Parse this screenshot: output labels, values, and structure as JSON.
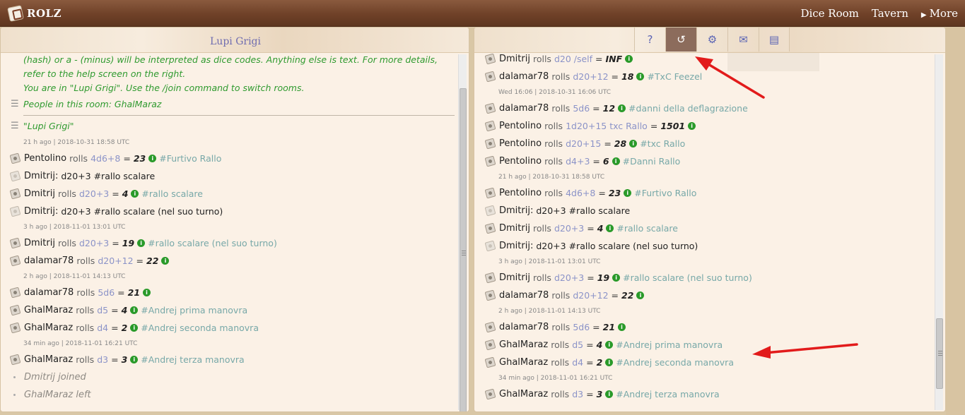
{
  "app": {
    "logo_text": "ROLZ",
    "nav": [
      {
        "label": "Dice Room"
      },
      {
        "label": "Tavern"
      },
      {
        "label": "More",
        "arrow": "▶"
      }
    ]
  },
  "left": {
    "room_title": "Lupi Grigi",
    "intro_lines": [
      "(hash) or a - (minus) will be interpreted as dice codes. Anything else is text. For more details,",
      "refer to the help screen on the right.",
      "You are in \"Lupi Grigi\". Use the /join command to switch rooms."
    ],
    "people_line": "People in this room: GhalMaraz",
    "room_line": "\"Lupi Grigi\"",
    "entries": [
      {
        "kind": "ts",
        "text": "21 h ago | 2018-10-31 18:58 UTC"
      },
      {
        "kind": "roll",
        "name": "Pentolino",
        "verb": "rolls",
        "code": "4d6+8",
        "eq": "=",
        "result": "23",
        "tag": "#Furtivo Rallo"
      },
      {
        "kind": "msg",
        "name": "Dmitrij:",
        "msg": "d20+3 #rallo scalare"
      },
      {
        "kind": "roll",
        "name": "Dmitrij",
        "verb": "rolls",
        "code": "d20+3",
        "eq": "=",
        "result": "4",
        "tag": "#rallo scalare"
      },
      {
        "kind": "msg",
        "name": "Dmitrij:",
        "msg": "d20+3 #rallo scalare (nel suo turno)"
      },
      {
        "kind": "ts",
        "text": "3 h ago | 2018-11-01 13:01 UTC"
      },
      {
        "kind": "roll",
        "name": "Dmitrij",
        "verb": "rolls",
        "code": "d20+3",
        "eq": "=",
        "result": "19",
        "tag": "#rallo scalare (nel suo turno)"
      },
      {
        "kind": "roll",
        "name": "dalamar78",
        "verb": "rolls",
        "code": "d20+12",
        "eq": "=",
        "result": "22",
        "tag": ""
      },
      {
        "kind": "ts",
        "text": "2 h ago | 2018-11-01 14:13 UTC"
      },
      {
        "kind": "roll",
        "name": "dalamar78",
        "verb": "rolls",
        "code": "5d6",
        "eq": "=",
        "result": "21",
        "tag": ""
      },
      {
        "kind": "roll",
        "name": "GhalMaraz",
        "verb": "rolls",
        "code": "d5",
        "eq": "=",
        "result": "4",
        "tag": "#Andrej prima manovra"
      },
      {
        "kind": "roll",
        "name": "GhalMaraz",
        "verb": "rolls",
        "code": "d4",
        "eq": "=",
        "result": "2",
        "tag": "#Andrej seconda manovra"
      },
      {
        "kind": "ts",
        "text": "34 min ago | 2018-11-01 16:21 UTC"
      },
      {
        "kind": "roll",
        "name": "GhalMaraz",
        "verb": "rolls",
        "code": "d3",
        "eq": "=",
        "result": "3",
        "tag": "#Andrej terza manovra"
      },
      {
        "kind": "join",
        "text": "Dmitrij joined"
      },
      {
        "kind": "join",
        "text": "GhalMaraz left"
      }
    ]
  },
  "right": {
    "toolbar": [
      {
        "name": "help-icon",
        "glyph": "?"
      },
      {
        "name": "history-icon",
        "glyph": "↺"
      },
      {
        "name": "gear-icon",
        "glyph": "⚙"
      },
      {
        "name": "mail-icon",
        "glyph": "✉"
      },
      {
        "name": "book-icon",
        "glyph": "▤"
      }
    ],
    "entries": [
      {
        "kind": "roll",
        "name": "Dmitrij",
        "verb": "rolls",
        "code": "d20 /self",
        "eq": "=",
        "result": "INF",
        "tag": ""
      },
      {
        "kind": "roll",
        "name": "dalamar78",
        "verb": "rolls",
        "code": "d20+12",
        "eq": "=",
        "result": "18",
        "tag": "#TxC Feezel"
      },
      {
        "kind": "ts",
        "text": "Wed 16:06 | 2018-10-31 16:06 UTC"
      },
      {
        "kind": "roll",
        "name": "dalamar78",
        "verb": "rolls",
        "code": "5d6",
        "eq": "=",
        "result": "12",
        "tag": "#danni della deflagrazione"
      },
      {
        "kind": "roll",
        "name": "Pentolino",
        "verb": "rolls",
        "code": "1d20+15 txc Rallo",
        "eq": "=",
        "result": "1501",
        "tag": ""
      },
      {
        "kind": "roll",
        "name": "Pentolino",
        "verb": "rolls",
        "code": "d20+15",
        "eq": "=",
        "result": "28",
        "tag": "#txc Rallo"
      },
      {
        "kind": "roll",
        "name": "Pentolino",
        "verb": "rolls",
        "code": "d4+3",
        "eq": "=",
        "result": "6",
        "tag": "#Danni Rallo"
      },
      {
        "kind": "ts",
        "text": "21 h ago | 2018-10-31 18:58 UTC"
      },
      {
        "kind": "roll",
        "name": "Pentolino",
        "verb": "rolls",
        "code": "4d6+8",
        "eq": "=",
        "result": "23",
        "tag": "#Furtivo Rallo"
      },
      {
        "kind": "msg",
        "name": "Dmitrij:",
        "msg": "d20+3 #rallo scalare"
      },
      {
        "kind": "roll",
        "name": "Dmitrij",
        "verb": "rolls",
        "code": "d20+3",
        "eq": "=",
        "result": "4",
        "tag": "#rallo scalare"
      },
      {
        "kind": "msg",
        "name": "Dmitrij:",
        "msg": "d20+3 #rallo scalare (nel suo turno)"
      },
      {
        "kind": "ts",
        "text": "3 h ago | 2018-11-01 13:01 UTC"
      },
      {
        "kind": "roll",
        "name": "Dmitrij",
        "verb": "rolls",
        "code": "d20+3",
        "eq": "=",
        "result": "19",
        "tag": "#rallo scalare (nel suo turno)"
      },
      {
        "kind": "roll",
        "name": "dalamar78",
        "verb": "rolls",
        "code": "d20+12",
        "eq": "=",
        "result": "22",
        "tag": ""
      },
      {
        "kind": "ts",
        "text": "2 h ago | 2018-11-01 14:13 UTC"
      },
      {
        "kind": "roll",
        "name": "dalamar78",
        "verb": "rolls",
        "code": "5d6",
        "eq": "=",
        "result": "21",
        "tag": ""
      },
      {
        "kind": "roll",
        "name": "GhalMaraz",
        "verb": "rolls",
        "code": "d5",
        "eq": "=",
        "result": "4",
        "tag": "#Andrej prima manovra"
      },
      {
        "kind": "roll",
        "name": "GhalMaraz",
        "verb": "rolls",
        "code": "d4",
        "eq": "=",
        "result": "2",
        "tag": "#Andrej seconda manovra"
      },
      {
        "kind": "ts",
        "text": "34 min ago | 2018-11-01 16:21 UTC"
      },
      {
        "kind": "roll",
        "name": "GhalMaraz",
        "verb": "rolls",
        "code": "d3",
        "eq": "=",
        "result": "3",
        "tag": "#Andrej terza manovra"
      }
    ]
  },
  "icons": {
    "menu": "☰",
    "info": "i"
  },
  "colors": {
    "header_brown": "#6f4128",
    "system_green": "#2f9a2f",
    "code_blue": "#8b93c8",
    "tag_teal": "#77a8a8",
    "arrow_red": "#e21b1b"
  }
}
